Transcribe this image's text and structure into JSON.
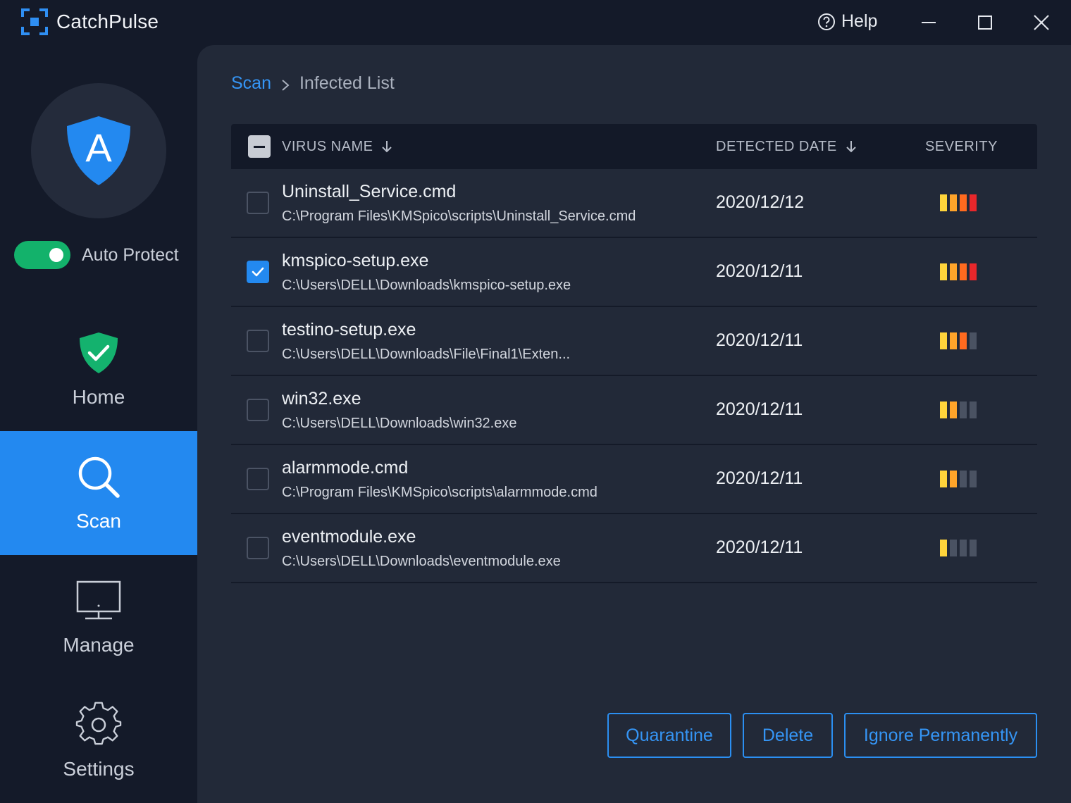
{
  "app": {
    "name": "CatchPulse",
    "help_label": "Help"
  },
  "sidebar": {
    "shield_letter": "A",
    "auto_protect": {
      "label": "Auto Protect",
      "enabled": true
    },
    "items": [
      {
        "label": "Home",
        "icon": "shield-check-icon",
        "active": false
      },
      {
        "label": "Scan",
        "icon": "search-icon",
        "active": true
      },
      {
        "label": "Manage",
        "icon": "monitor-icon",
        "active": false
      },
      {
        "label": "Settings",
        "icon": "gear-icon",
        "active": false
      }
    ]
  },
  "breadcrumb": {
    "parent": "Scan",
    "current": "Infected List"
  },
  "table": {
    "columns": {
      "name": "VIRUS NAME",
      "date": "DETECTED DATE",
      "severity": "SEVERITY"
    },
    "select_all_state": "indeterminate",
    "rows": [
      {
        "name": "Uninstall_Service.cmd",
        "path": "C:\\Program Files\\KMSpico\\scripts\\Uninstall_Service.cmd",
        "date": "2020/12/12",
        "severity": 4,
        "checked": false
      },
      {
        "name": "kmspico-setup.exe",
        "path": "C:\\Users\\DELL\\Downloads\\kmspico-setup.exe",
        "date": "2020/12/11",
        "severity": 4,
        "checked": true
      },
      {
        "name": "testino-setup.exe",
        "path": "C:\\Users\\DELL\\Downloads\\File\\Final1\\Exten...",
        "date": "2020/12/11",
        "severity": 3,
        "checked": false
      },
      {
        "name": "win32.exe",
        "path": "C:\\Users\\DELL\\Downloads\\win32.exe",
        "date": "2020/12/11",
        "severity": 2,
        "checked": false
      },
      {
        "name": "alarmmode.cmd",
        "path": "C:\\Program Files\\KMSpico\\scripts\\alarmmode.cmd",
        "date": "2020/12/11",
        "severity": 2,
        "checked": false
      },
      {
        "name": "eventmodule.exe",
        "path": "C:\\Users\\DELL\\Downloads\\eventmodule.exe",
        "date": "2020/12/11",
        "severity": 1,
        "checked": false
      }
    ]
  },
  "actions": {
    "quarantine": "Quarantine",
    "delete": "Delete",
    "ignore": "Ignore Permanently"
  },
  "colors": {
    "accent": "#2389f0",
    "toggle_on": "#13b26b",
    "severity_levels": [
      "#ffd43b",
      "#ffa42a",
      "#ff6a1f",
      "#e8272b"
    ],
    "severity_off": "#4a5262"
  }
}
